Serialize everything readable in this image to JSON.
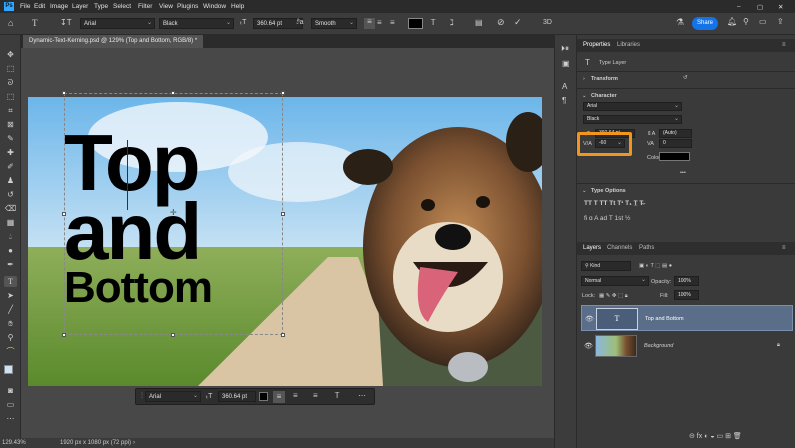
{
  "menu": [
    "File",
    "Edit",
    "Image",
    "Layer",
    "Type",
    "Select",
    "Filter",
    "View",
    "Plugins",
    "Window",
    "Help"
  ],
  "window_controls": [
    "–",
    "▢",
    "✕"
  ],
  "options": {
    "font_family": "Arial",
    "font_style": "Black",
    "font_size": "360.64 pt",
    "antialias": "Smooth",
    "share_label": "Share"
  },
  "document": {
    "tab_title": "Dynamic-Text-Kerning.psd @ 129% (Top and  Bottom, RGB/8) *",
    "text_line1": "Top",
    "text_line2": "and",
    "text_line3": "Bottom"
  },
  "context_bar": {
    "font": "Arial",
    "size": "360.64 pt"
  },
  "status": {
    "zoom": "129.43%",
    "dims": "1920 px x 1080 px (72 ppi)"
  },
  "properties": {
    "tabs": [
      "Properties",
      "Libraries"
    ],
    "type_layer_label": "Type Layer",
    "transform_label": "Transform",
    "character_label": "Character",
    "font_family": "Arial",
    "font_style": "Black",
    "size_value": "360.64 pt",
    "leading_value": "(Auto)",
    "kerning_value": "-60",
    "tracking_value": "0",
    "color_label": "Color",
    "color_value": "#000000",
    "type_options_label": "Type Options",
    "more": "•••"
  },
  "layers": {
    "tabs": [
      "Layers",
      "Channels",
      "Paths"
    ],
    "kind_label": "Kind",
    "blend_mode": "Normal",
    "opacity_label": "Opacity:",
    "opacity_value": "100%",
    "lock_label": "Lock:",
    "fill_label": "Fill:",
    "fill_value": "100%",
    "items": [
      {
        "name": "Top and  Bottom"
      },
      {
        "name": "Background"
      }
    ]
  },
  "colors": {
    "accent": "#1473e6",
    "highlight": "#f0961e"
  }
}
